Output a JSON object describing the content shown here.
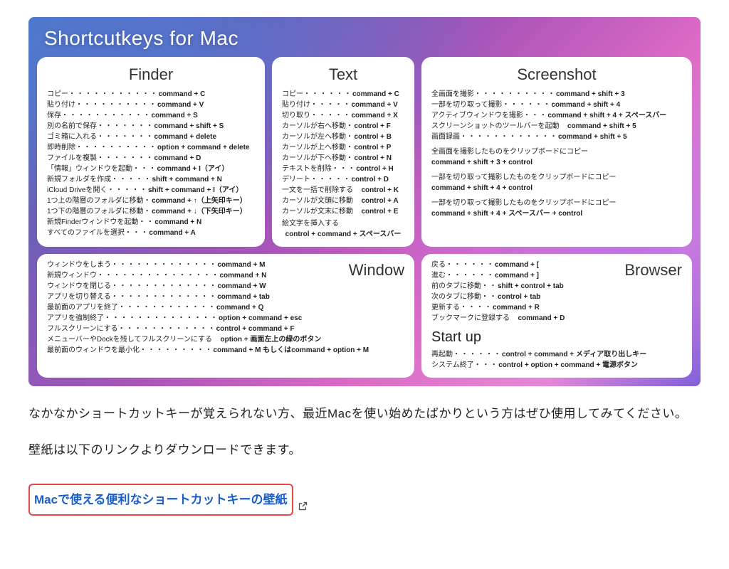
{
  "wallpaper": {
    "title": "Shortcutkeys for Mac",
    "finder": {
      "title": "Finder",
      "items": [
        {
          "label": "コピー",
          "dots": "・・・・・・・・・・・",
          "val": "command + C"
        },
        {
          "label": "貼り付け",
          "dots": "・・・・・・・・・・",
          "val": "command + V"
        },
        {
          "label": "保存",
          "dots": "・・・・・・・・・・・",
          "val": "command + S"
        },
        {
          "label": "別の名前で保存",
          "dots": "・・・・・・・",
          "val": "command + shift + S"
        },
        {
          "label": "ゴミ箱に入れる",
          "dots": "・・・・・・・",
          "val": "command + delete"
        },
        {
          "label": "即時削除",
          "dots": "・・・・・・・・・・",
          "val": "option + command + delete"
        },
        {
          "label": "ファイルを複製",
          "dots": "・・・・・・・",
          "val": "command + D"
        },
        {
          "label": "「情報」ウィンドウを起動",
          "dots": "・・・",
          "val": "command + I（アイ）"
        },
        {
          "label": "新規フォルダを作成",
          "dots": "・・・・・",
          "val": "shift + command + N"
        },
        {
          "label": "iCloud Driveを開く",
          "dots": "・・・・・",
          "val": "shift + command + I（アイ）"
        },
        {
          "label": "1つ上の階層のフォルダに移動",
          "dots": "・",
          "val": "command + ↑（上矢印キー）"
        },
        {
          "label": "1つ下の階層のフォルダに移動",
          "dots": "・",
          "val": "command + ↓（下矢印キー）"
        },
        {
          "label": "新規Finderウィンドウを起動",
          "dots": "・・",
          "val": "command + N"
        },
        {
          "label": "すべてのファイルを選択",
          "dots": "・・・",
          "val": "command + A"
        }
      ]
    },
    "text": {
      "title": "Text",
      "items": [
        {
          "label": "コピー",
          "dots": "・・・・・・",
          "val": "command + C"
        },
        {
          "label": "貼り付け",
          "dots": "・・・・・",
          "val": "command + V"
        },
        {
          "label": "切り取り",
          "dots": "・・・・・",
          "val": "command + X"
        },
        {
          "label": "カーソルが右へ移動",
          "dots": "・",
          "val": "control + F"
        },
        {
          "label": "カーソルが左へ移動",
          "dots": "・",
          "val": "control + B"
        },
        {
          "label": "カーソルが上へ移動",
          "dots": "・",
          "val": "control + P"
        },
        {
          "label": "カーソルが下へ移動",
          "dots": "・",
          "val": "control + N"
        },
        {
          "label": "テキストを削除",
          "dots": "・・・",
          "val": "control + H"
        },
        {
          "label": "デリート",
          "dots": "・・・・・",
          "val": "control + D"
        },
        {
          "label": "一文を一括で削除する",
          "dots": "　",
          "val": "control + K"
        },
        {
          "label": "カーソルが文頭に移動",
          "dots": "　",
          "val": "control + A"
        },
        {
          "label": "カーソルが文末に移動",
          "dots": "　",
          "val": "control + E"
        }
      ],
      "extra_label": "絵文字を挿入する",
      "extra_val": "control + command + スペースバー"
    },
    "screenshot": {
      "title": "Screenshot",
      "items": [
        {
          "label": "全画面を撮影",
          "dots": "・・・・・・・・・・",
          "val": "command + shift + 3"
        },
        {
          "label": "一部を切り取って撮影",
          "dots": "・・・・・・",
          "val": "command + shift + 4"
        },
        {
          "label": "アクティブウィンドウを撮影",
          "dots": "・・・",
          "val": "command + shift + 4 + スペースバー"
        },
        {
          "label": "スクリーンショットのツールバーを起動",
          "dots": "　",
          "val": "command + shift + 5"
        },
        {
          "label": "画面録画",
          "dots": "・・・・・・・・・・・・",
          "val": "command + shift + 5"
        }
      ],
      "notes": [
        {
          "a": "全画面を撮影したものをクリップボードにコピー",
          "b": "command + shift + 3 + control"
        },
        {
          "a": "一部を切り取って撮影したものをクリップボードにコピー",
          "b": "command + shift + 4 + control"
        },
        {
          "a": "一部を切り取って撮影したものをクリップボードにコピー",
          "b": "command + shift + 4 + スペースバー + control"
        }
      ]
    },
    "window": {
      "title": "Window",
      "items": [
        {
          "label": "ウィンドウをしまう",
          "dots": "・・・・・・・・・・・・・",
          "val": "command + M"
        },
        {
          "label": "新規ウィンドウ",
          "dots": "・・・・・・・・・・・・・・・",
          "val": "command + N"
        },
        {
          "label": "ウィンドウを閉じる",
          "dots": "・・・・・・・・・・・・・",
          "val": "command + W"
        },
        {
          "label": "アプリを切り替える",
          "dots": "・・・・・・・・・・・・・",
          "val": "command + tab"
        },
        {
          "label": "最前面のアプリを終了",
          "dots": "・・・・・・・・・・・・",
          "val": "command + Q"
        },
        {
          "label": "アプリを強制終了",
          "dots": "・・・・・・・・・・・・・・",
          "val": "option + command + esc"
        },
        {
          "label": "フルスクリーンにする",
          "dots": "・・・・・・・・・・・・",
          "val": "control + command + F"
        },
        {
          "label": "メニューバーやDockを残してフルスクリーンにする",
          "dots": "　",
          "val": "option + 画面左上の緑のボタン"
        },
        {
          "label": "最前面のウィンドウを最小化",
          "dots": "・・・・・・・・・",
          "val": "command + M もしくはcommand + option + M"
        }
      ]
    },
    "browser": {
      "title": "Browser",
      "items": [
        {
          "label": "戻る",
          "dots": "・・・・・・",
          "val": "command + ["
        },
        {
          "label": "進む",
          "dots": "・・・・・・",
          "val": "command + ]"
        },
        {
          "label": "前のタブに移動",
          "dots": "・・",
          "val": "shift + control + tab"
        },
        {
          "label": "次のタブに移動",
          "dots": "・・",
          "val": "control + tab"
        },
        {
          "label": "更新する",
          "dots": "・・・・",
          "val": "command + R"
        },
        {
          "label": "ブックマークに登録する",
          "dots": "　",
          "val": "command + D"
        }
      ]
    },
    "startup": {
      "title": "Start up",
      "items": [
        {
          "label": "再起動",
          "dots": "・・・・・・",
          "val": "control + command + メディア取り出しキー"
        },
        {
          "label": "システム終了",
          "dots": "・・・",
          "val": "control + option + command + 電源ボタン"
        }
      ]
    }
  },
  "article": {
    "p1": "なかなかショートカットキーが覚えられない方、最近Macを使い始めたばかりという方はぜひ使用してみてください。",
    "p2": "壁紙は以下のリンクよりダウンロードできます。",
    "link_text": "Macで使える便利なショートカットキーの壁紙"
  }
}
